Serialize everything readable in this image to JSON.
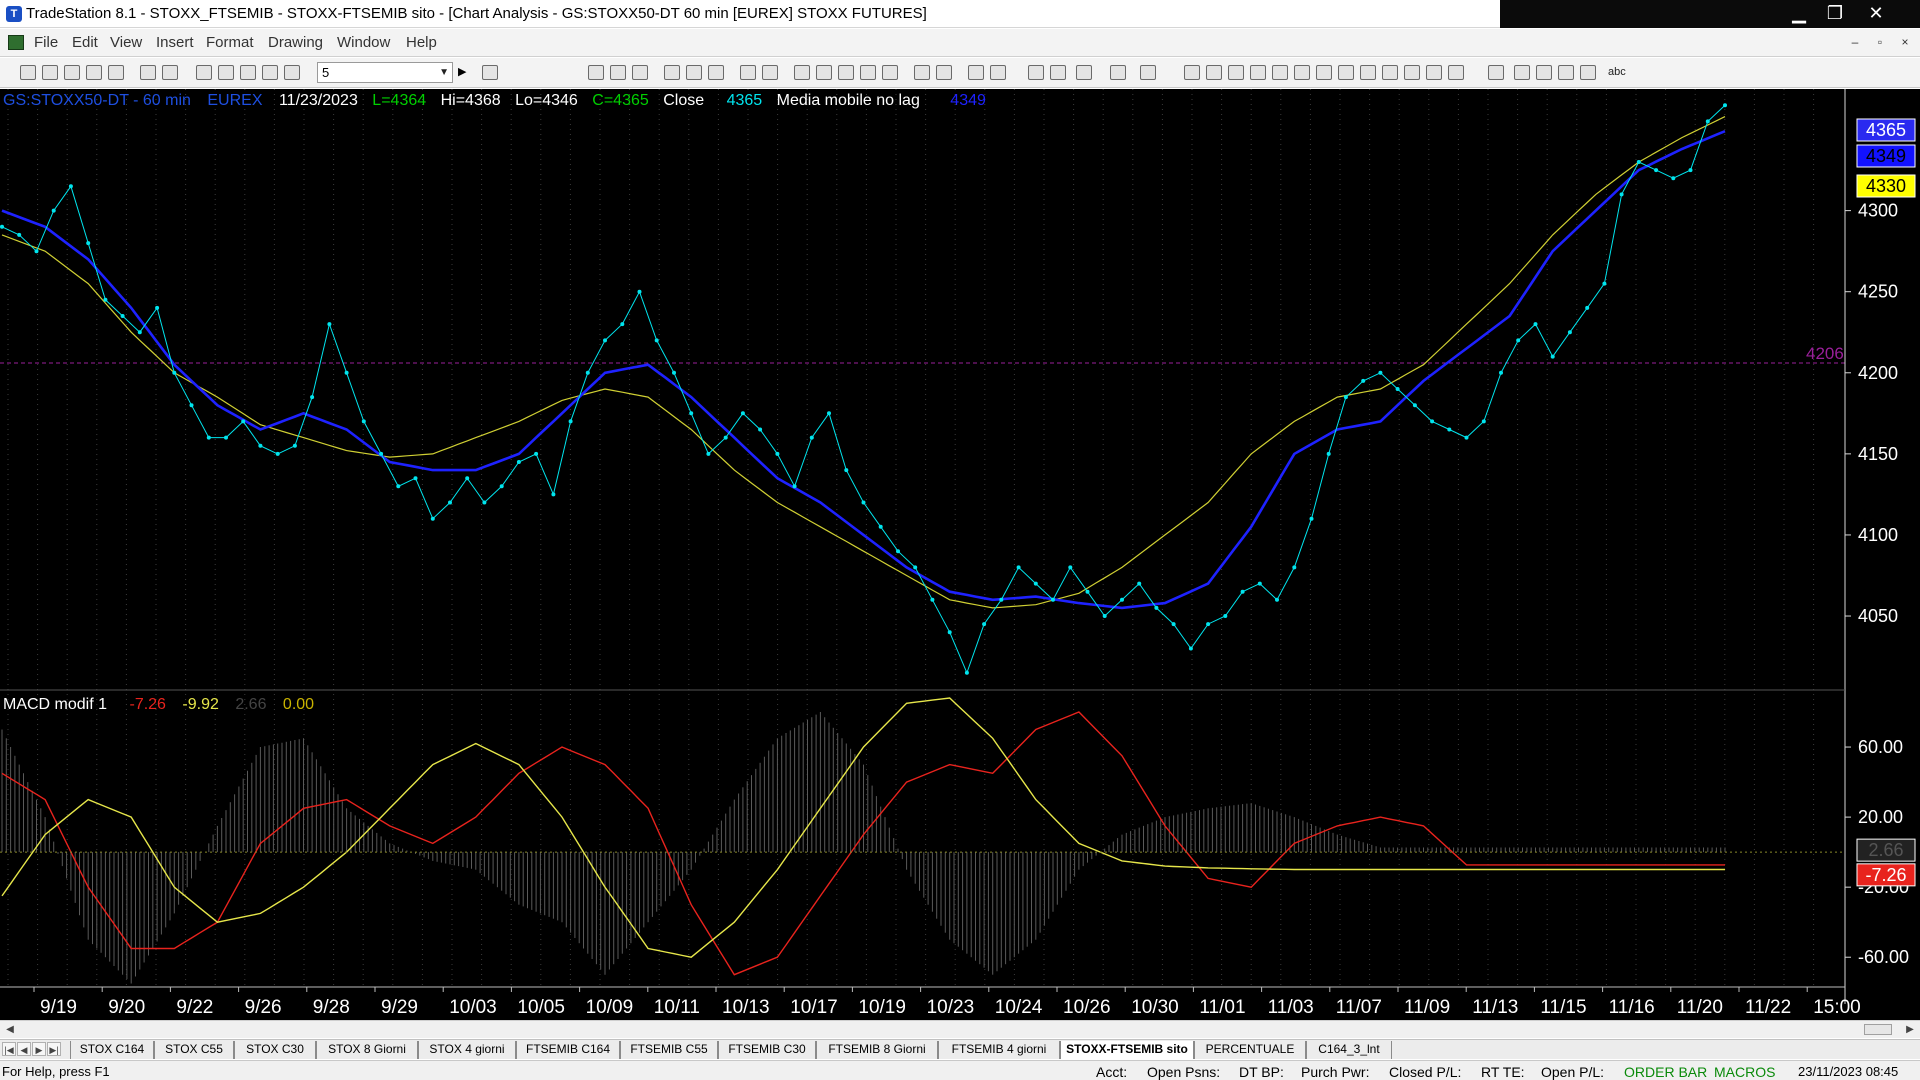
{
  "window": {
    "title": "TradeStation 8.1 - STOXX_FTSEMIB - STOXX-FTSEMIB sito - [Chart Analysis - GS:STOXX50-DT  60 min  [EUREX] STOXX FUTURES]",
    "minimize": "▁",
    "restore": "❐",
    "close": "✕"
  },
  "menu": {
    "items": [
      "File",
      "Edit",
      "View",
      "Insert",
      "Format",
      "Drawing",
      "Window",
      "Help"
    ],
    "mdi_minimize": "–",
    "mdi_restore": "▫",
    "mdi_close": "×"
  },
  "toolbar": {
    "selector_value": "5",
    "selector_arrow": "▼",
    "play": "▶",
    "text_tool": "abc"
  },
  "chart_header": {
    "symbol": "GS:STOXX50-DT - 60 min",
    "exchange": "EUREX",
    "date": "11/23/2023",
    "low": "L=4364",
    "high": "Hi=4368",
    "lo": "Lo=4346",
    "close": "C=4365",
    "close_label": "Close",
    "close_value": "4365",
    "indicator": "Media mobile no lag",
    "indicator_value": "4349"
  },
  "macd_header": {
    "name": "MACD modif 1",
    "v1": "-7.26",
    "v2": "-9.92",
    "v3": "2.66",
    "v4": "0.00"
  },
  "colors": {
    "background": "#000000",
    "close_series": "#00e5ee",
    "ma_fast": "#1e22ff",
    "ma_slow": "#cfcf33",
    "macd_red": "#e8231d",
    "macd_yellow": "#e6e64a",
    "histogram": "#5a5a5a",
    "hline": "#9a1f9a",
    "axis_text": "#ffffff"
  },
  "chart_data": [
    {
      "type": "line",
      "title": "",
      "y_axis_position": "right",
      "ylim": [
        4005,
        4375
      ],
      "yticks": [
        "4300",
        "4250",
        "4200",
        "4150",
        "4100",
        "4050"
      ],
      "x_tick_labels": [
        "9/19",
        "9/20",
        "9/22",
        "9/26",
        "9/28",
        "9/29",
        "10/03",
        "10/05",
        "10/09",
        "10/11",
        "10/13",
        "10/17",
        "10/19",
        "10/23",
        "10/24",
        "10/26",
        "10/30",
        "11/01",
        "11/03",
        "11/07",
        "11/09",
        "11/13",
        "11/15",
        "11/16",
        "11/20",
        "11/22",
        "15:00"
      ],
      "price_labels": {
        "close": "4365",
        "fast": "4349",
        "slow": "4330"
      },
      "horizontal_line": {
        "value": 4206,
        "label": "4206"
      },
      "series": [
        {
          "name": "Close",
          "x": [
            0,
            4,
            8,
            12,
            16,
            20,
            24,
            28,
            32,
            36,
            40,
            44,
            48,
            52,
            56,
            60,
            64,
            68,
            72,
            76,
            80,
            84,
            88,
            92,
            96,
            100,
            104,
            108,
            112,
            116,
            120,
            124,
            128,
            132,
            136,
            140,
            144,
            148,
            152,
            156,
            160,
            164,
            168,
            172,
            176,
            180,
            184,
            188,
            192,
            196,
            200,
            204,
            208,
            212,
            216,
            220,
            224,
            228,
            232,
            236,
            240,
            244,
            248,
            252,
            256,
            260,
            264,
            268,
            272,
            276,
            280,
            284,
            288,
            292,
            296,
            300,
            304,
            308,
            312,
            316,
            320,
            324,
            328,
            332,
            336,
            340,
            344,
            348,
            352,
            356,
            360,
            364,
            368,
            372,
            376,
            380,
            384,
            388,
            392,
            396,
            400
          ],
          "values": [
            4290,
            4285,
            4275,
            4300,
            4315,
            4280,
            4245,
            4235,
            4225,
            4240,
            4200,
            4180,
            4160,
            4160,
            4170,
            4155,
            4150,
            4155,
            4185,
            4230,
            4200,
            4170,
            4150,
            4130,
            4135,
            4110,
            4120,
            4135,
            4120,
            4130,
            4145,
            4150,
            4125,
            4170,
            4200,
            4220,
            4230,
            4250,
            4220,
            4200,
            4175,
            4150,
            4160,
            4175,
            4165,
            4150,
            4130,
            4160,
            4175,
            4140,
            4120,
            4105,
            4090,
            4080,
            4060,
            4040,
            4015,
            4045,
            4060,
            4080,
            4070,
            4060,
            4080,
            4065,
            4050,
            4060,
            4070,
            4055,
            4045,
            4030,
            4045,
            4050,
            4065,
            4070,
            4060,
            4080,
            4110,
            4150,
            4185,
            4195,
            4200,
            4190,
            4180,
            4170,
            4165,
            4160,
            4170,
            4200,
            4220,
            4230,
            4210,
            4225,
            4240,
            4255,
            4310,
            4330,
            4325,
            4320,
            4325,
            4355,
            4365
          ]
        },
        {
          "name": "Media mobile no lag",
          "x": [
            0,
            10,
            20,
            30,
            40,
            50,
            60,
            70,
            80,
            90,
            100,
            110,
            120,
            130,
            140,
            150,
            160,
            170,
            180,
            190,
            200,
            210,
            220,
            230,
            240,
            250,
            260,
            270,
            280,
            290,
            300,
            310,
            320,
            330,
            340,
            350,
            360,
            370,
            380,
            390,
            400
          ],
          "values": [
            4300,
            4290,
            4270,
            4240,
            4205,
            4180,
            4165,
            4175,
            4165,
            4145,
            4140,
            4140,
            4150,
            4175,
            4200,
            4205,
            4185,
            4160,
            4135,
            4120,
            4100,
            4080,
            4065,
            4060,
            4062,
            4058,
            4055,
            4058,
            4070,
            4105,
            4150,
            4165,
            4170,
            4195,
            4215,
            4235,
            4275,
            4300,
            4325,
            4338,
            4349
          ]
        },
        {
          "name": "",
          "x": [
            0,
            10,
            20,
            30,
            40,
            50,
            60,
            70,
            80,
            90,
            100,
            110,
            120,
            130,
            140,
            150,
            160,
            170,
            180,
            190,
            200,
            210,
            220,
            230,
            240,
            250,
            260,
            270,
            280,
            290,
            300,
            310,
            320,
            330,
            340,
            350,
            360,
            370,
            380,
            390,
            400
          ],
          "values": [
            4285,
            4275,
            4255,
            4225,
            4200,
            4185,
            4168,
            4160,
            4152,
            4148,
            4150,
            4160,
            4170,
            4183,
            4190,
            4185,
            4165,
            4140,
            4120,
            4105,
            4090,
            4075,
            4060,
            4055,
            4057,
            4064,
            4080,
            4100,
            4120,
            4150,
            4170,
            4185,
            4190,
            4205,
            4230,
            4255,
            4285,
            4310,
            4330,
            4345,
            4358
          ]
        }
      ]
    },
    {
      "type": "line",
      "title": "",
      "y_axis_position": "right",
      "ylim": [
        -77,
        92
      ],
      "yticks": [
        "60.00",
        "20.00",
        "-20.00",
        "-60.00"
      ],
      "price_labels": {
        "v3": "2.66",
        "v1": "-7.26"
      },
      "series": [
        {
          "name": "",
          "x": [
            0,
            10,
            20,
            30,
            40,
            50,
            60,
            70,
            80,
            90,
            100,
            110,
            120,
            130,
            140,
            150,
            160,
            170,
            180,
            190,
            200,
            210,
            220,
            230,
            240,
            250,
            260,
            270,
            280,
            290,
            300,
            310,
            320,
            330,
            340,
            350,
            360,
            370,
            380,
            390,
            400
          ],
          "values": [
            45,
            30,
            -20,
            -55,
            -55,
            -40,
            5,
            25,
            30,
            15,
            5,
            20,
            45,
            60,
            50,
            25,
            -30,
            -70,
            -60,
            -25,
            10,
            40,
            50,
            45,
            70,
            80,
            55,
            15,
            -15,
            -20,
            5,
            15,
            20,
            15,
            -7.26,
            -7.26,
            -7.26,
            -7.26,
            -7.26,
            -7.26,
            -7.26
          ]
        },
        {
          "name": "",
          "x": [
            0,
            10,
            20,
            30,
            40,
            50,
            60,
            70,
            80,
            90,
            100,
            110,
            120,
            130,
            140,
            150,
            160,
            170,
            180,
            190,
            200,
            210,
            220,
            230,
            240,
            250,
            260,
            270,
            280,
            290,
            300,
            310,
            320,
            330,
            340,
            350,
            360,
            370,
            380,
            390,
            400
          ],
          "values": [
            -25,
            10,
            30,
            20,
            -20,
            -40,
            -35,
            -20,
            0,
            25,
            50,
            62,
            50,
            20,
            -20,
            -55,
            -60,
            -40,
            -10,
            25,
            60,
            85,
            88,
            65,
            30,
            5,
            -5,
            -8,
            -9,
            -9.5,
            -9.9,
            -9.9,
            -9.92,
            -9.92,
            -9.92,
            -9.92,
            -9.92,
            -9.92,
            -9.92,
            -9.92,
            -9.92
          ]
        },
        {
          "name": "",
          "x": [
            0,
            10,
            20,
            30,
            40,
            50,
            60,
            70,
            80,
            90,
            100,
            110,
            120,
            130,
            140,
            150,
            160,
            170,
            180,
            190,
            200,
            210,
            220,
            230,
            240,
            250,
            260,
            270,
            280,
            290,
            300,
            310,
            320,
            330,
            340,
            350,
            360,
            370,
            380,
            390,
            400
          ],
          "values": [
            70,
            20,
            -50,
            -75,
            -35,
            15,
            60,
            65,
            25,
            5,
            -5,
            -10,
            -30,
            -40,
            -70,
            -40,
            -10,
            30,
            65,
            80,
            50,
            -10,
            -50,
            -70,
            -50,
            -10,
            10,
            20,
            25,
            28,
            20,
            10,
            2.66,
            2.66,
            2.66,
            2.66,
            2.66,
            2.66,
            2.66,
            2.66,
            2.66
          ]
        }
      ]
    }
  ],
  "tabs": [
    "STOX C164",
    "STOX C55",
    "STOX  C30",
    "STOX  8 Giorni",
    "STOX 4 giorni",
    "FTSEMIB C164",
    "FTSEMIB C55",
    "FTSEMIB C30",
    "FTSEMIB  8 Giorni",
    "FTSEMIB  4 giorni",
    "STOXX-FTSEMIB sito",
    "PERCENTUALE",
    "C164_3_lnt"
  ],
  "active_tab": "STOXX-FTSEMIB sito",
  "tab_nav": [
    "|◀",
    "◀",
    "▶",
    "▶|"
  ],
  "status": {
    "help": "For Help, press F1",
    "acct": "Acct:",
    "open_psns": "Open Psns:",
    "dt_bp": "DT BP:",
    "purch_pwr": "Purch Pwr:",
    "closed_pl": "Closed P/L:",
    "rt_te": "RT TE:",
    "open_pl": "Open P/L:",
    "order_bar": "ORDER BAR",
    "macros": "MACROS",
    "datetime": "23/11/2023 08:45"
  }
}
